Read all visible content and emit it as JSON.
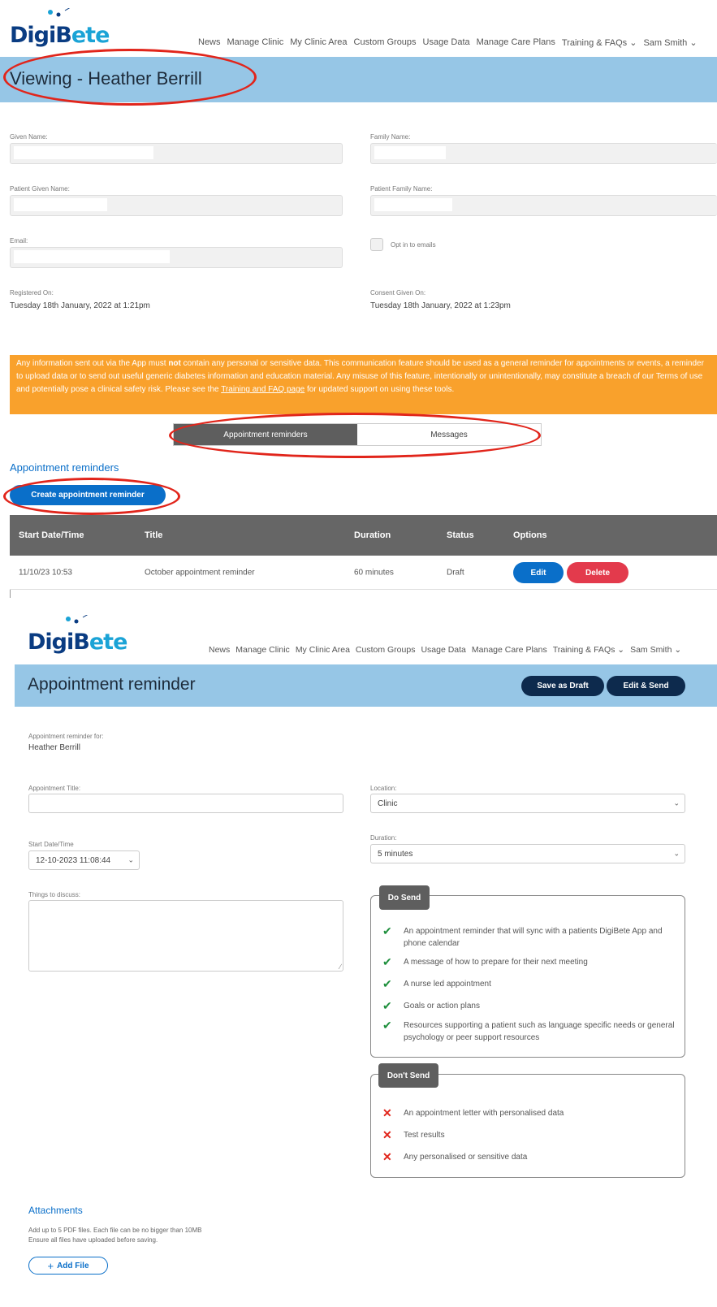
{
  "brand": {
    "logo_text_a": "DigiB",
    "logo_text_b": "ete"
  },
  "nav": {
    "items": [
      "News",
      "Manage Clinic",
      "My Clinic Area",
      "Custom Groups",
      "Usage Data",
      "Manage Care Plans",
      "Training & FAQs",
      "Sam Smith"
    ]
  },
  "view": {
    "title": "Viewing - Heather Berrill",
    "given_name_label": "Given Name:",
    "family_name_label": "Family Name:",
    "patient_given_label": "Patient Given Name:",
    "patient_family_label": "Patient Family Name:",
    "email_label": "Email:",
    "opt_in_label": "Opt in to emails",
    "registered_label": "Registered On:",
    "registered_value": "Tuesday 18th January, 2022 at 1:21pm",
    "consent_label": "Consent Given On:",
    "consent_value": "Tuesday 18th January, 2022 at 1:23pm",
    "warning_pre": "Any information sent out via the App must ",
    "warning_bold": "not",
    "warning_mid": " contain any personal or sensitive data. This communication feature should be used as a general reminder for appointments or events, a reminder to upload data or to send out useful generic diabetes information and education material. Any misuse of this feature, intentionally or unintentionally, may constitute a breach of our Terms of use and potentially pose a clinical safety risk. Please see the ",
    "warning_link": "Training and FAQ page",
    "warning_post": " for updated support on using these tools.",
    "tab_reminders": "Appointment reminders",
    "tab_messages": "Messages",
    "section_title": "Appointment reminders",
    "create_button": "Create appointment reminder",
    "table_headers": [
      "Start Date/Time",
      "Title",
      "Duration",
      "Status",
      "Options"
    ],
    "rows": [
      {
        "start": "11/10/23 10:53",
        "title": "October appointment reminder",
        "duration": "60 minutes",
        "status": "Draft",
        "edit": "Edit",
        "delete": "Delete"
      }
    ]
  },
  "form": {
    "title": "Appointment reminder",
    "save_draft": "Save as Draft",
    "edit_send": "Edit & Send",
    "for_label": "Appointment reminder for:",
    "for_value": "Heather Berrill",
    "appt_title_label": "Appointment Title:",
    "location_label": "Location:",
    "location_value": "Clinic",
    "start_label": "Start Date/Time",
    "start_value": "12-10-2023 11:08:44",
    "duration_label": "Duration:",
    "duration_value": "5 minutes",
    "discuss_label": "Things to discuss:",
    "do_send_title": "Do Send",
    "do_send_items": [
      "An appointment reminder that will sync with a patients DigiBete App and phone calendar",
      "A message of how to prepare for their next meeting",
      "A nurse led appointment",
      "Goals or action plans",
      "Resources supporting a patient such as language specific needs or general psychology or peer support resources"
    ],
    "dont_send_title": "Don't Send",
    "dont_send_items": [
      "An appointment letter with personalised data",
      "Test results",
      "Any personalised or sensitive data"
    ],
    "attachments_title": "Attachments",
    "attachments_note1": "Add up to 5 PDF files. Each file can be no bigger than 10MB",
    "attachments_note2": "Ensure all files have uploaded before saving.",
    "add_file": "Add File"
  },
  "colors": {
    "banner": "#96c6e6",
    "warning": "#f9a12c",
    "primary": "#0a6fc9",
    "danger": "#e33a4c",
    "dark": "#0d2a4d",
    "annotation": "#e1251b"
  }
}
